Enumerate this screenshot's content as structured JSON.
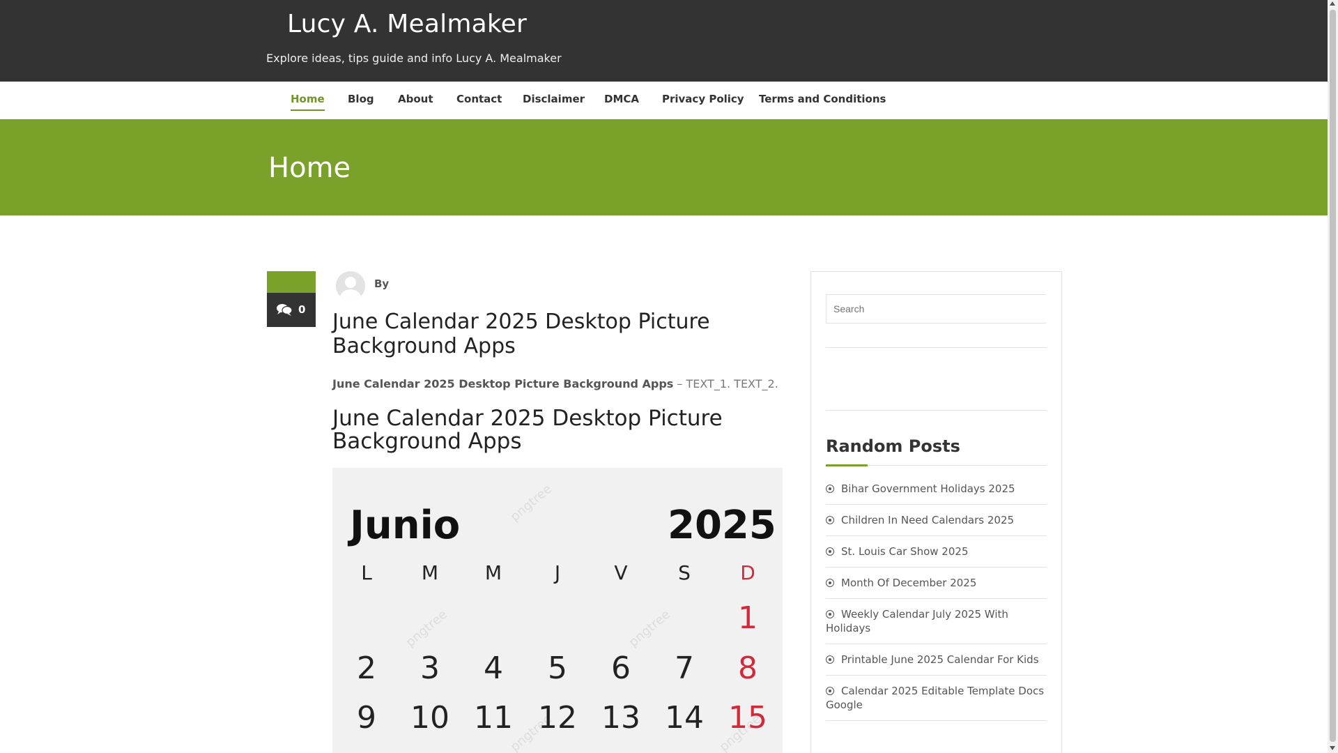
{
  "site": {
    "title": "Lucy A. Mealmaker",
    "tagline": "Explore ideas, tips guide and info Lucy A. Mealmaker"
  },
  "nav": {
    "items": [
      "Home",
      "Blog",
      "About",
      "Contact",
      "Disclaimer",
      "DMCA",
      "Privacy Policy",
      "Terms and Conditions"
    ],
    "active": "Home"
  },
  "banner": {
    "title": "Home"
  },
  "post": {
    "comment_count": "0",
    "by_label": "By",
    "title": "June Calendar 2025 Desktop Picture Background Apps",
    "excerpt_bold": "June Calendar 2025 Desktop Picture Background Apps",
    "excerpt_rest": " – TEXT_1. TEXT_2.",
    "subheading": "June Calendar 2025 Desktop Picture Background Apps"
  },
  "calendar_image": {
    "month": "Junio",
    "year": "2025",
    "weekdays": [
      "L",
      "M",
      "M",
      "J",
      "V",
      "S",
      "D"
    ],
    "row1": [
      "",
      "",
      "",
      "",
      "",
      "",
      "1"
    ],
    "row2": [
      "2",
      "3",
      "4",
      "5",
      "6",
      "7",
      "8"
    ],
    "row3": [
      "9",
      "10",
      "11",
      "12",
      "13",
      "14",
      "15"
    ],
    "watermark": "pngtree"
  },
  "sidebar": {
    "search_placeholder": "Search",
    "random_posts_title": "Random Posts",
    "random_posts": [
      "Bihar Government Holidays 2025",
      "Children In Need Calendars 2025",
      "St. Louis Car Show 2025",
      "Month Of December 2025",
      "Weekly Calendar July 2025 With Holidays",
      "Printable June 2025 Calendar For Kids",
      "Calendar 2025 Editable Template Docs Google"
    ]
  },
  "colors": {
    "accent": "#7aa22a",
    "dark": "#333333",
    "sunday": "#d22a3a"
  }
}
